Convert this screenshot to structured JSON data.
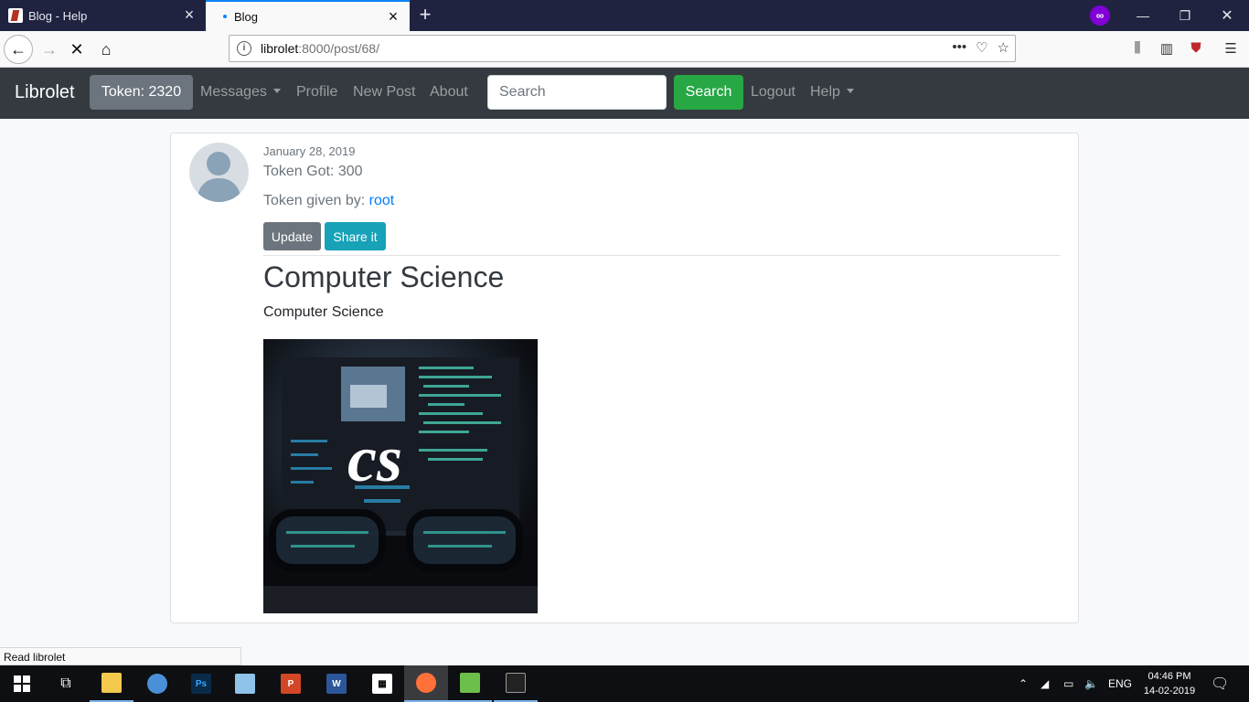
{
  "browser": {
    "tabs": [
      {
        "title": "Blog - Help",
        "active": false
      },
      {
        "title": "Blog",
        "active": true
      }
    ],
    "url_host": "librolet",
    "url_rest": ":8000/post/68/",
    "status_text": "Read librolet"
  },
  "site_nav": {
    "brand": "Librolet",
    "token_label": "Token: 2320",
    "messages": "Messages",
    "profile": "Profile",
    "new_post": "New Post",
    "about": "About",
    "search_placeholder": "Search",
    "search_button": "Search",
    "logout": "Logout",
    "help": "Help"
  },
  "post": {
    "date": "January 28, 2019",
    "token_got": "Token Got: 300",
    "given_by_label": "Token given by: ",
    "given_by_user": "root",
    "update_label": "Update",
    "share_label": "Share it",
    "title": "Computer Science",
    "body": "Computer Science",
    "image_text": "cs"
  },
  "taskbar": {
    "language": "ENG",
    "time": "04:46 PM",
    "date": "14-02-2019"
  }
}
